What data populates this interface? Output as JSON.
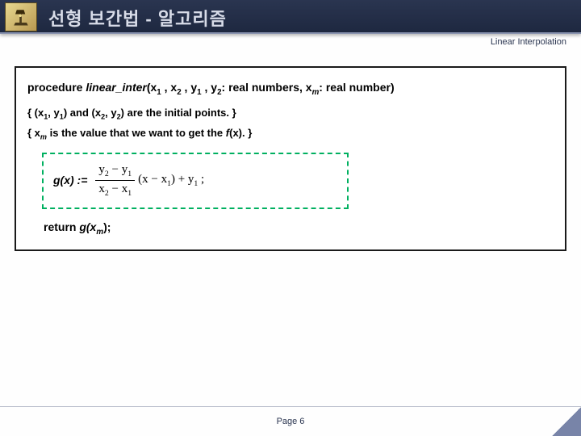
{
  "header": {
    "title_ko": "선형 보간법 - 알고리즘",
    "subtitle_en": "Linear Interpolation"
  },
  "procedure": {
    "keyword": "procedure",
    "name": "linear_inter",
    "params_part1": "(x",
    "p1": "1",
    "comma1": " , x",
    "p2": "2",
    "comma2": " , y",
    "p3": "1",
    "comma3": " , y",
    "p4": "2",
    "params_part2": ": real numbers, x",
    "pm": "m",
    "params_part3": ": real number)"
  },
  "comment1": {
    "open": "{ (x",
    "s1": "1",
    "mid1": ", y",
    "s2": "1",
    "mid2": ") and (x",
    "s3": "2",
    "mid3": ", y",
    "s4": "2",
    "close": ") are the initial points. }"
  },
  "comment2": {
    "open": "{ x",
    "s1": "m",
    "mid": " is the value that we want to get the ",
    "fx": "f",
    "fxparen": "(x). }"
  },
  "formula": {
    "label": "g(x) :=",
    "num_a": "y",
    "num_a_sub": "2",
    "num_minus": " − y",
    "num_b_sub": "1",
    "den_a": "x",
    "den_a_sub": "2",
    "den_minus": " − x",
    "den_b_sub": "1",
    "after_open": "(x − x",
    "after_sub": "1",
    "after_close": ") + y",
    "plus_sub": "1",
    "semi": " ;"
  },
  "return": {
    "kw": "return",
    "expr": " g(x",
    "sub": "m",
    "close": ");"
  },
  "footer": {
    "page": "Page 6"
  }
}
